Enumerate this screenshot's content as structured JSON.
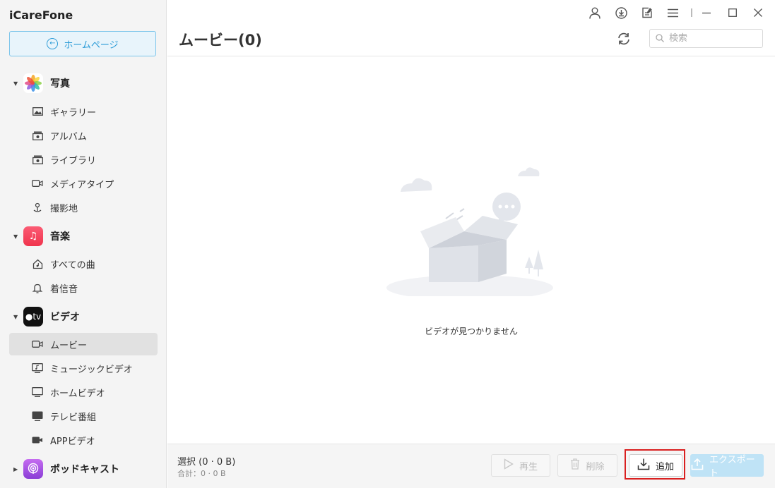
{
  "app": {
    "title": "iCareFone"
  },
  "sidebar": {
    "home_label": "ホームページ",
    "categories": [
      {
        "label": "写真",
        "icon": "photos-icon",
        "items": [
          {
            "label": "ギャラリー",
            "icon": "image-icon"
          },
          {
            "label": "アルバム",
            "icon": "album-icon"
          },
          {
            "label": "ライブラリ",
            "icon": "library-icon"
          },
          {
            "label": "メディアタイプ",
            "icon": "video-camera-icon"
          },
          {
            "label": "撮影地",
            "icon": "location-pin-icon"
          }
        ]
      },
      {
        "label": "音楽",
        "icon": "music-icon",
        "items": [
          {
            "label": "すべての曲",
            "icon": "music-home-icon"
          },
          {
            "label": "着信音",
            "icon": "bell-icon"
          }
        ]
      },
      {
        "label": "ビデオ",
        "icon": "apple-tv-icon",
        "icon_text": "tv",
        "items": [
          {
            "label": "ムービー",
            "icon": "video-camera-icon",
            "active": true
          },
          {
            "label": "ミュージックビデオ",
            "icon": "music-video-icon"
          },
          {
            "label": "ホームビデオ",
            "icon": "monitor-icon"
          },
          {
            "label": "テレビ番組",
            "icon": "tv-show-icon"
          },
          {
            "label": "APPビデオ",
            "icon": "app-video-icon"
          }
        ]
      },
      {
        "label": "ポッドキャスト",
        "icon": "podcast-icon",
        "items": []
      }
    ]
  },
  "header": {
    "title": "ムービー(0)",
    "search_placeholder": "検索"
  },
  "main": {
    "empty_message": "ビデオが見つかりません"
  },
  "footer": {
    "selection": "選択 (0 · 0 B)",
    "total": "合計：0 · 0 B",
    "play_label": "再生",
    "delete_label": "削除",
    "add_label": "追加",
    "export_label": "エクスポート"
  },
  "colors": {
    "accent": "#2b9bd7",
    "highlight": "#d92020",
    "export_disabled": "#bfe3f6"
  }
}
